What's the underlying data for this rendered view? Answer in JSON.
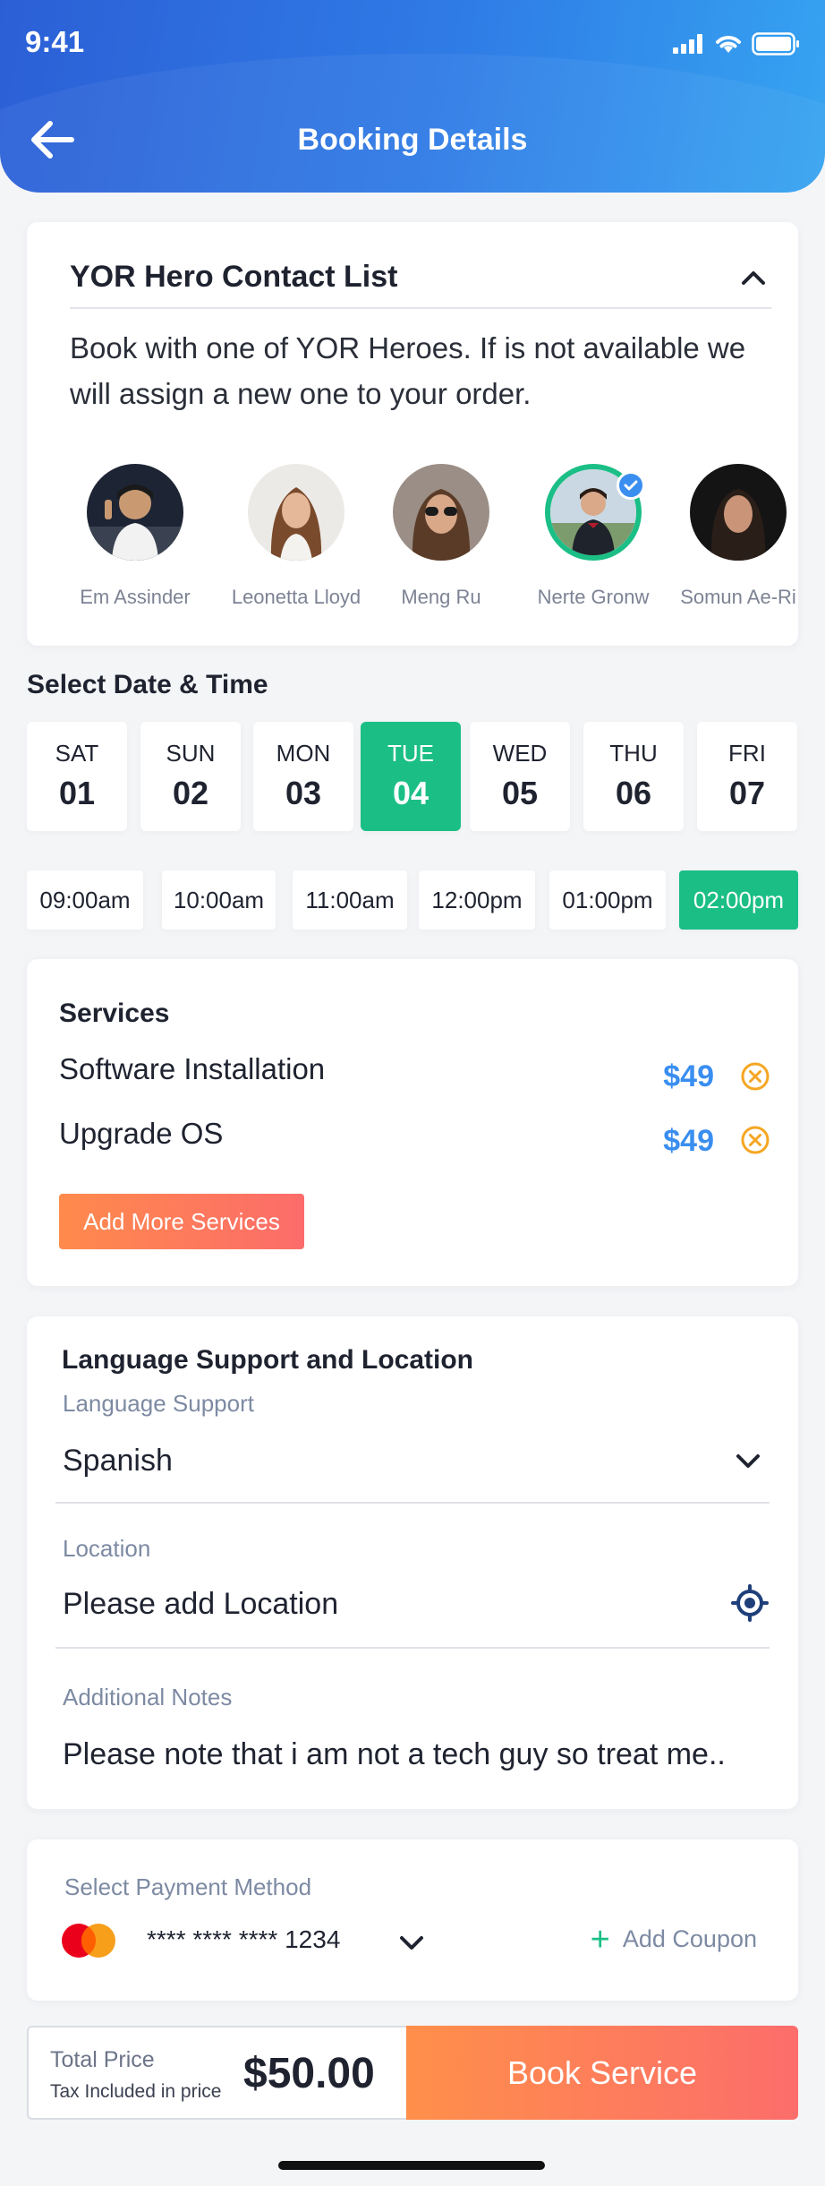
{
  "status_bar": {
    "time": "9:41"
  },
  "header": {
    "title": "Booking Details"
  },
  "hero_list": {
    "title": "YOR Hero Contact List",
    "description": "Book with one of YOR Heroes. If is not available we will assign a new one to your order.",
    "heroes": [
      {
        "name": "Em Assinder",
        "selected": false
      },
      {
        "name": "Leonetta Lloyd",
        "selected": false
      },
      {
        "name": "Meng Ru",
        "selected": false
      },
      {
        "name": "Nerte Gronw",
        "selected": true
      },
      {
        "name": "Somun Ae-Ri",
        "selected": false
      }
    ]
  },
  "date_time": {
    "title": "Select Date & Time",
    "days": [
      {
        "name": "SAT",
        "num": "01"
      },
      {
        "name": "SUN",
        "num": "02"
      },
      {
        "name": "MON",
        "num": "03"
      },
      {
        "name": "TUE",
        "num": "04",
        "active": true
      },
      {
        "name": "WED",
        "num": "05"
      },
      {
        "name": "THU",
        "num": "06"
      },
      {
        "name": "FRI",
        "num": "07"
      }
    ],
    "times": [
      "09:00am",
      "10:00am",
      "11:00am",
      "12:00pm",
      "01:00pm",
      "02:00pm"
    ],
    "selected_time": "02:00pm"
  },
  "services": {
    "title": "Services",
    "items": [
      {
        "name": "Software Installation",
        "price": "$49"
      },
      {
        "name": "Upgrade OS",
        "price": "$49"
      }
    ],
    "add_more_label": "Add More Services"
  },
  "language": {
    "title": "Language Support and Location",
    "language_label": "Language Support",
    "language_value": "Spanish",
    "location_label": "Location",
    "location_placeholder": "Please add Location",
    "notes_label": "Additional Notes",
    "notes_value": "Please note that i am not a tech guy so treat me.."
  },
  "payment": {
    "label": "Select Payment Method",
    "card_brand": "MasterCard",
    "card_number": "**** **** **** 1234",
    "coupon_label": "Add Coupon"
  },
  "footer": {
    "total_label": "Total Price",
    "tax_label": "Tax Included in price",
    "total_value": "$50.00",
    "book_label": "Book Service"
  },
  "colors": {
    "accent_green": "#1bbf86",
    "price_blue": "#3a8ef0",
    "orange": "#ff8a4c",
    "header_blue": "#2f7ce6"
  }
}
